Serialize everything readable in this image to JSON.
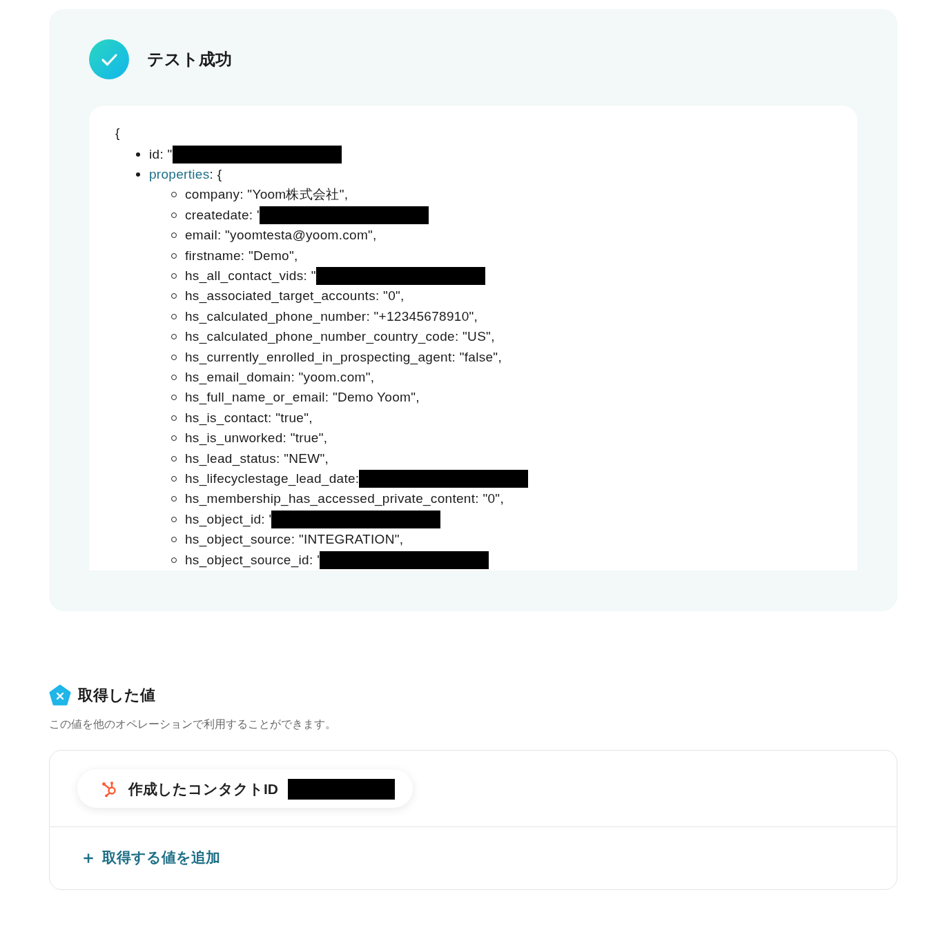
{
  "test_result": {
    "title": "テスト成功"
  },
  "output": {
    "open_brace": "{",
    "items": [
      {
        "text": "id: \"",
        "redacted": true
      },
      {
        "key": "properties",
        "text": ": {",
        "redacted": false,
        "children": [
          {
            "text": "company: \"Yoom株式会社\",",
            "redacted": false
          },
          {
            "text": "createdate: '",
            "redacted": true
          },
          {
            "text": "email: \"yoomtesta@yoom.com\",",
            "redacted": false
          },
          {
            "text": "firstname: \"Demo\",",
            "redacted": false
          },
          {
            "text": "hs_all_contact_vids: \"",
            "redacted": true
          },
          {
            "text": "hs_associated_target_accounts: \"0\",",
            "redacted": false
          },
          {
            "text": "hs_calculated_phone_number: \"+12345678910\",",
            "redacted": false
          },
          {
            "text": "hs_calculated_phone_number_country_code: \"US\",",
            "redacted": false
          },
          {
            "text": "hs_currently_enrolled_in_prospecting_agent: \"false\",",
            "redacted": false
          },
          {
            "text": "hs_email_domain: \"yoom.com\",",
            "redacted": false
          },
          {
            "text": "hs_full_name_or_email: \"Demo Yoom\",",
            "redacted": false
          },
          {
            "text": "hs_is_contact: \"true\",",
            "redacted": false
          },
          {
            "text": "hs_is_unworked: \"true\",",
            "redacted": false
          },
          {
            "text": "hs_lead_status: \"NEW\",",
            "redacted": false
          },
          {
            "text": "hs_lifecyclestage_lead_date:",
            "redacted": true
          },
          {
            "text": "hs_membership_has_accessed_private_content: \"0\",",
            "redacted": false
          },
          {
            "text": "hs_object_id: '",
            "redacted": true
          },
          {
            "text": "hs_object_source: \"INTEGRATION\",",
            "redacted": false
          },
          {
            "text": "hs_object_source_id: '",
            "redacted": true
          }
        ]
      }
    ]
  },
  "values_section": {
    "title": "取得した値",
    "description": "この値を他のオペレーションで利用することができます。",
    "values": [
      {
        "label": "作成したコンタクトID",
        "redacted": true
      }
    ],
    "add_button": {
      "label": "＋",
      "text": "取得する値を追加"
    }
  }
}
